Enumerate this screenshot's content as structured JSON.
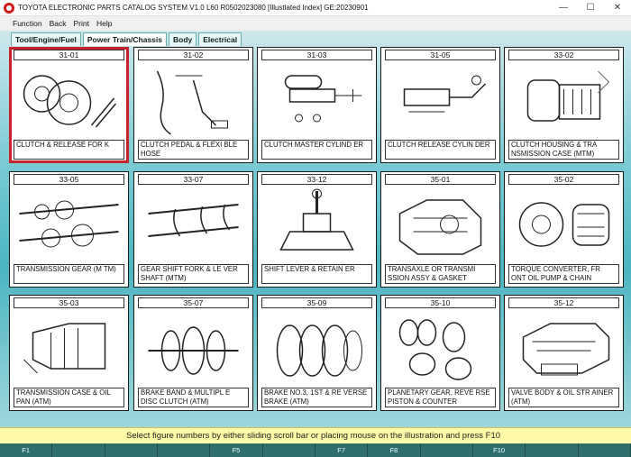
{
  "window": {
    "title": "TOYOTA ELECTRONIC PARTS CATALOG SYSTEM V1.0 L60 R0502023080 [Illustlated Index] GE:20230901",
    "minimize": "—",
    "maximize": "☐",
    "close": "✕"
  },
  "menu": [
    "Function",
    "Back",
    "Print",
    "Help"
  ],
  "tabs": [
    "Tool/Engine/Fuel",
    "Power Train/Chassis",
    "Body",
    "Electrical"
  ],
  "active_tab": 1,
  "cards": [
    {
      "code": "31-01",
      "label": "CLUTCH & RELEASE FOR K",
      "art": "clutch"
    },
    {
      "code": "31-02",
      "label": "CLUTCH PEDAL & FLEXI BLE HOSE",
      "art": "pedal"
    },
    {
      "code": "31-03",
      "label": "CLUTCH MASTER CYLIND ER",
      "art": "master"
    },
    {
      "code": "31-05",
      "label": "CLUTCH RELEASE CYLIN DER",
      "art": "release"
    },
    {
      "code": "33-02",
      "label": "CLUTCH HOUSING & TRA NSMISSION CASE (MTM)",
      "art": "housing"
    },
    {
      "code": "33-05",
      "label": "TRANSMISSION GEAR (M TM)",
      "art": "gears"
    },
    {
      "code": "33-07",
      "label": "GEAR SHIFT FORK & LE VER SHAFT (MTM)",
      "art": "fork"
    },
    {
      "code": "33-12",
      "label": "SHIFT LEVER & RETAIN ER",
      "art": "lever"
    },
    {
      "code": "35-01",
      "label": "TRANSAXLE OR TRANSMI SSION ASSY & GASKET",
      "art": "transaxle"
    },
    {
      "code": "35-02",
      "label": "TORQUE CONVERTER, FR ONT OIL PUMP & CHAIN",
      "art": "torque"
    },
    {
      "code": "35-03",
      "label": "TRANSMISSION CASE & OIL PAN (ATM)",
      "art": "case"
    },
    {
      "code": "35-07",
      "label": "BRAKE BAND & MULTIPL E DISC CLUTCH (ATM)",
      "art": "band"
    },
    {
      "code": "35-09",
      "label": "BRAKE NO.3, 1ST & RE VERSE BRAKE (ATM)",
      "art": "brake"
    },
    {
      "code": "35-10",
      "label": "PLANETARY GEAR, REVE RSE PISTON & COUNTER",
      "art": "planetary"
    },
    {
      "code": "35-12",
      "label": "VALVE BODY & OIL STR AINER (ATM)",
      "art": "valve"
    }
  ],
  "selected_card": 0,
  "status": "Select figure numbers by either sliding scroll bar or placing mouse on the illustration and press F10",
  "fkeys": [
    "F1",
    "",
    "",
    "",
    "F5",
    "",
    "F7",
    "F8",
    "",
    "F10",
    "",
    ""
  ],
  "colors": {
    "selected_border": "#c8232c",
    "status_bg": "#fffaa8",
    "fkey_bg": "#2f6e6a"
  }
}
